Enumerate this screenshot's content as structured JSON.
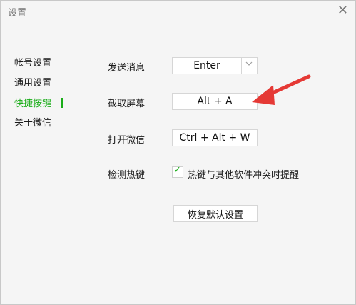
{
  "window": {
    "title": "设置",
    "close_glyph": "✕"
  },
  "sidebar": {
    "items": [
      {
        "label": "帐号设置"
      },
      {
        "label": "通用设置"
      },
      {
        "label": "快捷按键"
      },
      {
        "label": "关于微信"
      }
    ],
    "active_index": 2
  },
  "shortcuts": [
    {
      "label": "发送消息",
      "value": "Enter"
    },
    {
      "label": "截取屏幕",
      "value": "Alt + A"
    },
    {
      "label": "打开微信",
      "value": "Ctrl + Alt + W"
    }
  ],
  "hotkeys": {
    "label": "检测热键",
    "checkbox_label": "热键与其他软件冲突时提醒",
    "checked": true
  },
  "reset_button": {
    "label": "恢复默认设置"
  },
  "colors": {
    "accent": "#1aad19",
    "arrow": "#e53935"
  }
}
